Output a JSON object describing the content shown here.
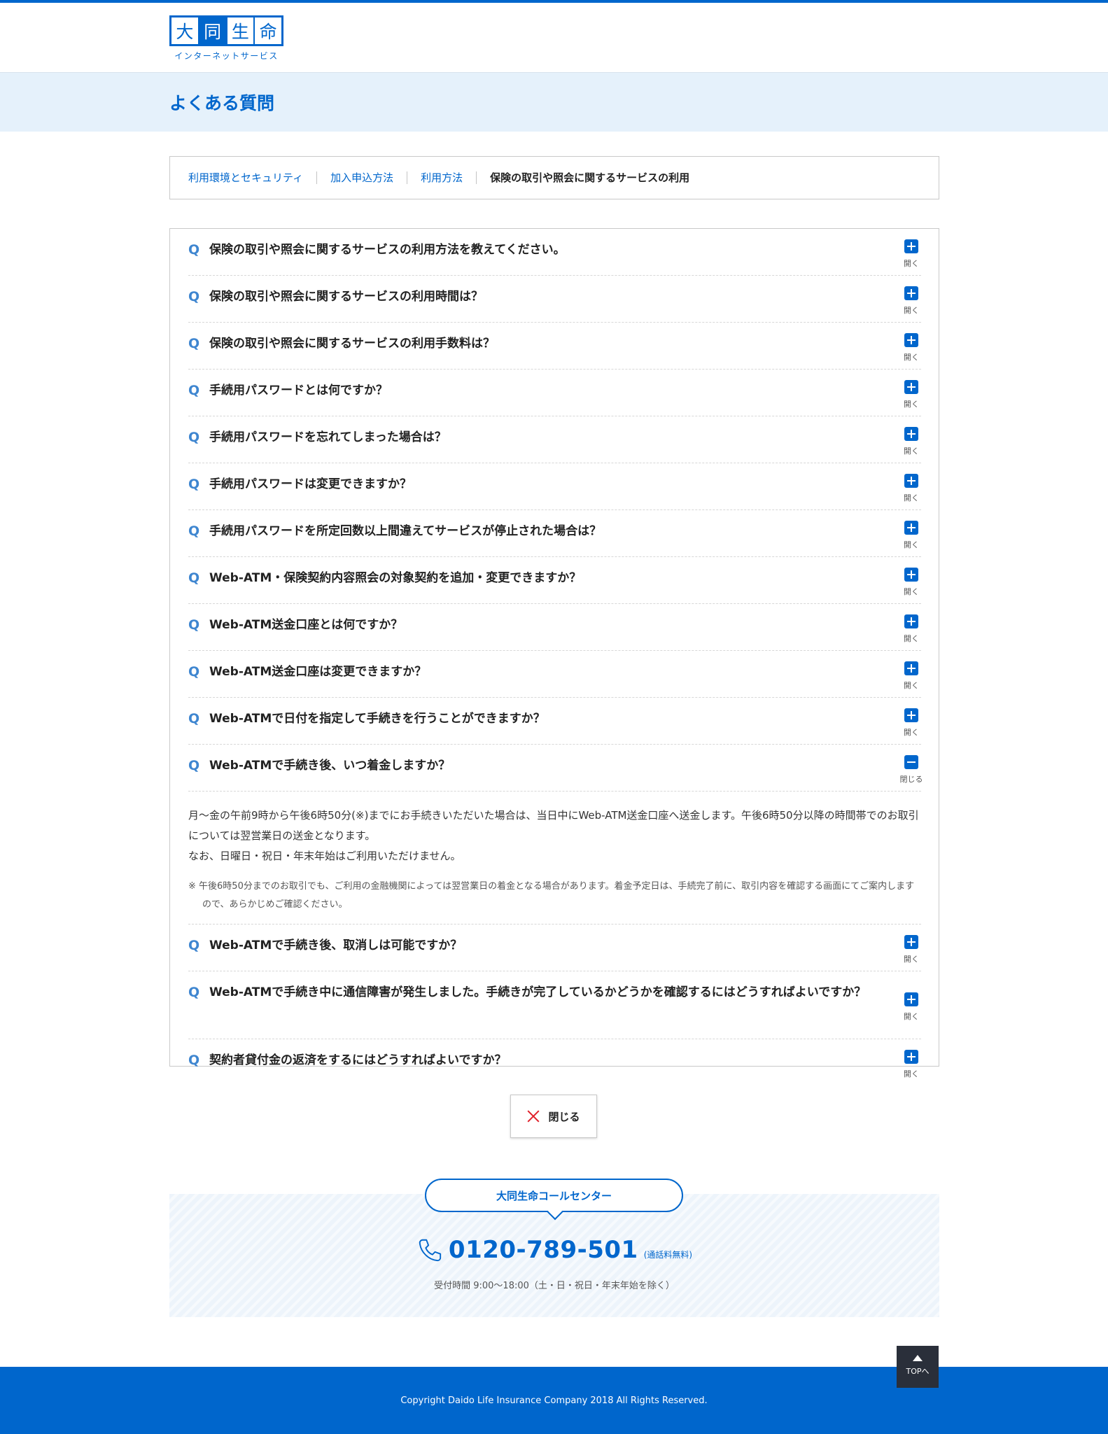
{
  "header": {
    "logo_chars": [
      "大",
      "同",
      "生",
      "命"
    ],
    "logo_sub": "インターネットサービス"
  },
  "page_title": "よくある質問",
  "category_nav": [
    {
      "label": "利用環境とセキュリティ",
      "active": false
    },
    {
      "label": "加入申込方法",
      "active": false
    },
    {
      "label": "利用方法",
      "active": false
    },
    {
      "label": "保険の取引や照会に関するサービスの利用",
      "active": true
    }
  ],
  "faq": {
    "q_mark": "Q",
    "open_label": "開く",
    "close_label": "閉じる",
    "items": [
      {
        "question": "保険の取引や照会に関するサービスの利用方法を教えてください。"
      },
      {
        "question": "保険の取引や照会に関するサービスの利用時間は？"
      },
      {
        "question": "保険の取引や照会に関するサービスの利用手数料は？"
      },
      {
        "question": "手続用パスワードとは何ですか？"
      },
      {
        "question": "手続用パスワードを忘れてしまった場合は？"
      },
      {
        "question": "手続用パスワードは変更できますか？"
      },
      {
        "question": "手続用パスワードを所定回数以上間違えてサービスが停止された場合は？"
      },
      {
        "question": "Web-ATM・保険契約内容照会の対象契約を追加・変更できますか？"
      },
      {
        "question": "Web-ATM送金口座とは何ですか？"
      },
      {
        "question": "Web-ATM送金口座は変更できますか？"
      },
      {
        "question": "Web-ATMで日付を指定して手続きを行うことができますか？"
      },
      {
        "question": "Web-ATMで手続き後、いつ着金しますか？"
      },
      {
        "question": "Web-ATMで手続き後、取消しは可能ですか？"
      },
      {
        "question": "Web-ATMで手続き中に通信障害が発生しました。手続きが完了しているかどうかを確認するにはどうすればよいですか？"
      },
      {
        "question": "契約者貸付金の返済をするにはどうすればよいですか？"
      }
    ],
    "open_answer": {
      "line1": "月～金の午前9時から午後6時50分(※)までにお手続きいただいた場合は、当日中にWeb-ATM送金口座へ送金します。午後6時50分以降の時間帯でのお取引については翌営業日の送金となります。",
      "line2": "なお、日曜日・祝日・年末年始はご利用いただけません。",
      "note": "※ 午後6時50分までのお取引でも、ご利用の金融機関によっては翌営業日の着金となる場合があります。着金予定日は、手続完了前に、取引内容を確認する画面にてご案内しますので、あらかじめご確認ください。"
    }
  },
  "close_button": "閉じる",
  "call_center": {
    "title": "大同生命コールセンター",
    "phone": "0120-789-501",
    "free_note": "(通話料無料)",
    "hours": "受付時間 9:00～18:00（土・日・祝日・年末年始を除く）"
  },
  "top_button": "TOPへ",
  "footer": {
    "copyright": "Copyright Daido Life Insurance Company 2018 All Rights Reserved."
  },
  "colors": {
    "brand": "#0066cc",
    "title_band": "#e5f1fb",
    "close_x": "#e0202a"
  }
}
